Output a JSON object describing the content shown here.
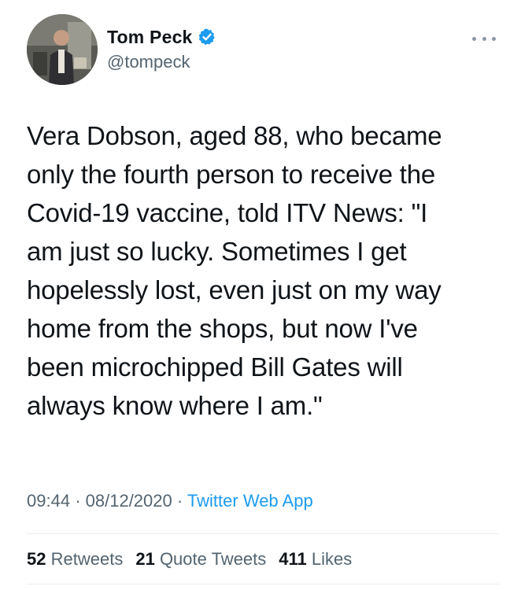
{
  "author": {
    "display_name": "Tom Peck",
    "handle": "@tompeck",
    "verified": true,
    "avatar_icon": "profile-photo",
    "verified_icon": "verified-badge-icon",
    "verified_color": "#1d9bf0"
  },
  "tweet": {
    "lines": [
      "Vera Dobson, aged 88, who became",
      "only the fourth person to receive the",
      "Covid-19 vaccine, told ITV News: \"I",
      "am just so lucky. Sometimes I get",
      "hopelessly lost, even just on my way",
      "home from the shops, but now I've",
      "been microchipped Bill Gates will",
      "always know where I am.\""
    ]
  },
  "meta": {
    "time": "09:44",
    "separator": "·",
    "date": "08/12/2020",
    "source": "Twitter Web App"
  },
  "stats": {
    "retweets_count": "52",
    "retweets_label": "Retweets",
    "quotes_count": "21",
    "quotes_label": "Quote Tweets",
    "likes_count": "411",
    "likes_label": "Likes"
  },
  "colors": {
    "text": "#0f1419",
    "secondary": "#536471",
    "link": "#1d9bf0",
    "divider": "#e6ecf0"
  }
}
